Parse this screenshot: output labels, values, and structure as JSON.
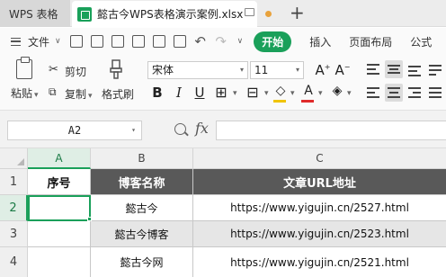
{
  "titlebar": {
    "app_tab": "WPS 表格",
    "doc_tab": "懿古今WPS表格演示案例.xlsx"
  },
  "menubar": {
    "file": "文件",
    "start": "开始",
    "insert": "插入",
    "page_layout": "页面布局",
    "formula_partial": "公式"
  },
  "ribbon": {
    "paste": "粘贴",
    "cut": "剪切",
    "copy": "复制",
    "format_painter": "格式刷",
    "font_name": "宋体",
    "font_size": "11",
    "bold": "B",
    "italic": "I",
    "underline": "U"
  },
  "formula": {
    "cell_ref": "A2",
    "fx": "fx",
    "value": ""
  },
  "grid": {
    "columns": [
      "A",
      "B",
      "C"
    ],
    "rows": [
      "1",
      "2",
      "3",
      "4"
    ],
    "header": [
      "序号",
      "博客名称",
      "文章URL地址"
    ],
    "data": [
      [
        "",
        "懿古今",
        "https://www.yigujin.cn/2527.html"
      ],
      [
        "",
        "懿古今博客",
        "https://www.yigujin.cn/2523.html"
      ],
      [
        "",
        "懿古今网",
        "https://www.yigujin.cn/2521.html"
      ]
    ],
    "selected_cell": "A2"
  },
  "colors": {
    "accent": "#1aa05a",
    "header_dark": "#595959",
    "shade": "#e6e6e6"
  }
}
